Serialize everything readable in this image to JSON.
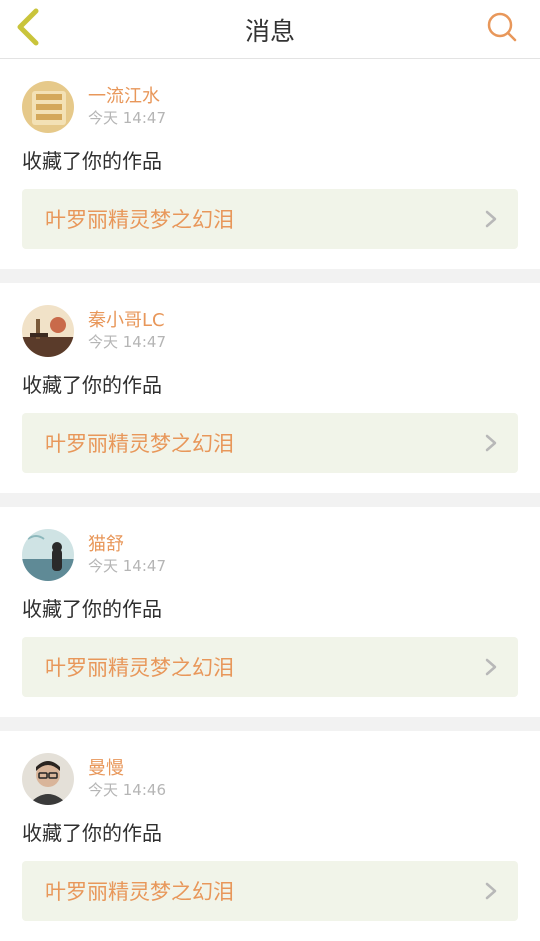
{
  "header": {
    "title": "消息"
  },
  "colors": {
    "accent": "#e8975a",
    "work_bg": "#f1f4e9",
    "back": "#c9c43b"
  },
  "messages": [
    {
      "name": "一流江水",
      "time": "今天 14:47",
      "action": "收藏了你的作品",
      "work": "叶罗丽精灵梦之幻泪"
    },
    {
      "name": "秦小哥LC",
      "time": "今天 14:47",
      "action": "收藏了你的作品",
      "work": "叶罗丽精灵梦之幻泪"
    },
    {
      "name": "猫舒",
      "time": "今天 14:47",
      "action": "收藏了你的作品",
      "work": "叶罗丽精灵梦之幻泪"
    },
    {
      "name": "曼慢",
      "time": "今天 14:46",
      "action": "收藏了你的作品",
      "work": "叶罗丽精灵梦之幻泪"
    }
  ]
}
